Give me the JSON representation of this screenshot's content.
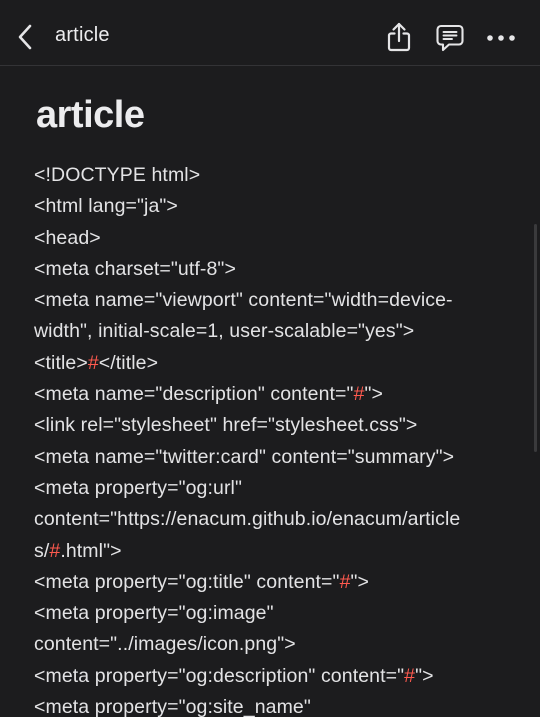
{
  "header": {
    "title": "article",
    "icons": {
      "back": "chevron-left-icon",
      "share": "share-icon",
      "comment": "comment-icon",
      "more": "more-icon"
    }
  },
  "document": {
    "title": "article",
    "lines": [
      {
        "text": "<!DOCTYPE html>"
      },
      {
        "text": "<html lang=\"ja\">"
      },
      {
        "text": "<head>"
      },
      {
        "text": "<meta charset=\"utf-8\">"
      },
      {
        "text": "<meta name=\"viewport\" content=\"width=device-"
      },
      {
        "text": "width\", initial-scale=1, user-scalable=\"yes\">"
      },
      {
        "pre": "<title>",
        "hash": "#",
        "post": "</title>"
      },
      {
        "pre": "<meta name=\"description\" content=\"",
        "hash": "#",
        "post": "\">"
      },
      {
        "text": "<link rel=\"stylesheet\" href=\"stylesheet.css\">"
      },
      {
        "text": "<meta name=\"twitter:card\" content=\"summary\">"
      },
      {
        "text": "<meta property=\"og:url\""
      },
      {
        "text": "content=\"https://enacum.github.io/enacum/article"
      },
      {
        "pre": "s/",
        "hash": "#",
        "post": ".html\">"
      },
      {
        "pre": "<meta property=\"og:title\" content=\"",
        "hash": "#",
        "post": "\">"
      },
      {
        "text": "<meta property=\"og:image\""
      },
      {
        "text": "content=\"../images/icon.png\">"
      },
      {
        "pre": "<meta property=\"og:description\" content=\"",
        "hash": "#",
        "post": "\">"
      },
      {
        "text": "<meta property=\"og:site_name\""
      }
    ]
  },
  "colors": {
    "background": "#1c1c1e",
    "text": "#e3e3e5",
    "hash_accent": "#ff5a4f"
  }
}
